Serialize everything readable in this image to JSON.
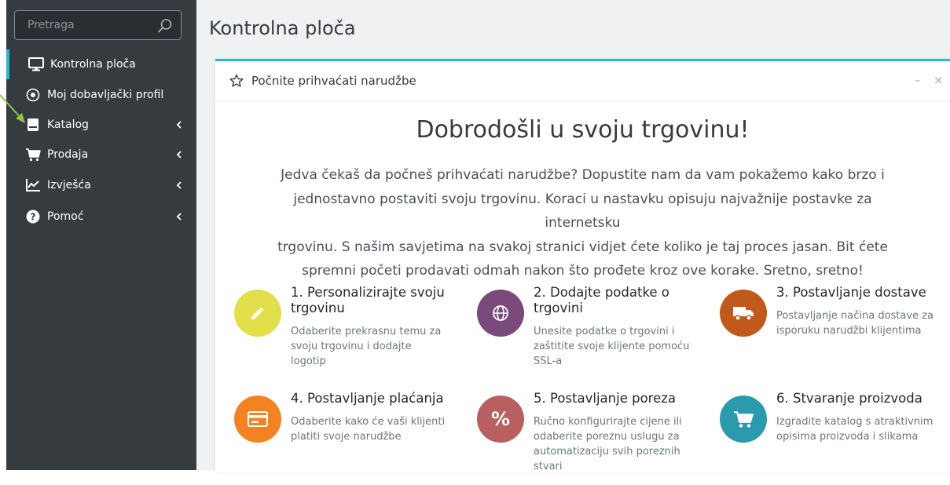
{
  "sidebar": {
    "search": {
      "placeholder": "Pretraga"
    },
    "items": [
      {
        "label": "Kontrolna ploča",
        "icon": "monitor-icon",
        "active": true
      },
      {
        "label": "Moj dobavljački profil",
        "icon": "radio-circle-icon"
      },
      {
        "label": "Katalog",
        "icon": "book-icon",
        "has_submenu": true
      },
      {
        "label": "Prodaja",
        "icon": "cart-icon",
        "has_submenu": true
      },
      {
        "label": "Izvješća",
        "icon": "chart-line-icon",
        "has_submenu": true
      },
      {
        "label": "Pomoć",
        "icon": "help-circle-icon",
        "has_submenu": true
      }
    ]
  },
  "header": {
    "title": "Kontrolna ploča"
  },
  "card": {
    "title": "Počnite prihvaćati narudžbe",
    "minimize": "–",
    "close": "×",
    "welcome": "Dobrodošli u svoju trgovinu!",
    "intro_lines": [
      "Jedva čekaš da počneš prihvaćati narudžbe? Dopustite nam da vam pokažemo kako brzo i",
      "jednostavno postaviti svoju trgovinu. Koraci u nastavku opisuju najvažnije postavke za internetsku",
      "trgovinu. S našim savjetima na svakoj stranici vidjet ćete koliko je taj proces jasan. Bit ćete",
      "spremni početi prodavati odmah nakon što prođete kroz ove korake. Sretno, sretno!"
    ],
    "steps": [
      {
        "title": "1.  Personalizirajte svoju trgovinu",
        "desc": "Odaberite prekrasnu temu za svoju trgovinu i dodajte logotip",
        "color": "#e1df4a",
        "icon": "pencil-icon"
      },
      {
        "title": "2.  Dodajte podatke o trgovini",
        "desc": "Unesite podatke o trgovini i zaštitite svoje klijente pomoću SSL-a",
        "color": "#7a4a7a",
        "icon": "globe-icon"
      },
      {
        "title": "3.  Postavljanje dostave",
        "desc": "Postavljanje načina dostave za isporuku narudžbi klijentima",
        "color": "#c0591a",
        "icon": "truck-icon"
      },
      {
        "title": "4.  Postavljanje plaćanja",
        "desc": "Odaberite kako će vaši klijenti platiti svoje narudžbe",
        "color": "#f58220",
        "icon": "credit-card-icon"
      },
      {
        "title": "5.  Postavljanje poreza",
        "desc": "Ručno konfigurirajte cijene ili odaberite poreznu uslugu za automatizaciju svih poreznih stvari",
        "color": "#b85f5f",
        "icon": "percent-icon"
      },
      {
        "title": "6.  Stvaranje proizvoda",
        "desc": "Izgradite katalog s atraktivnim opisima proizvoda i slikama",
        "color": "#2a9aac",
        "icon": "cart-icon"
      }
    ]
  }
}
